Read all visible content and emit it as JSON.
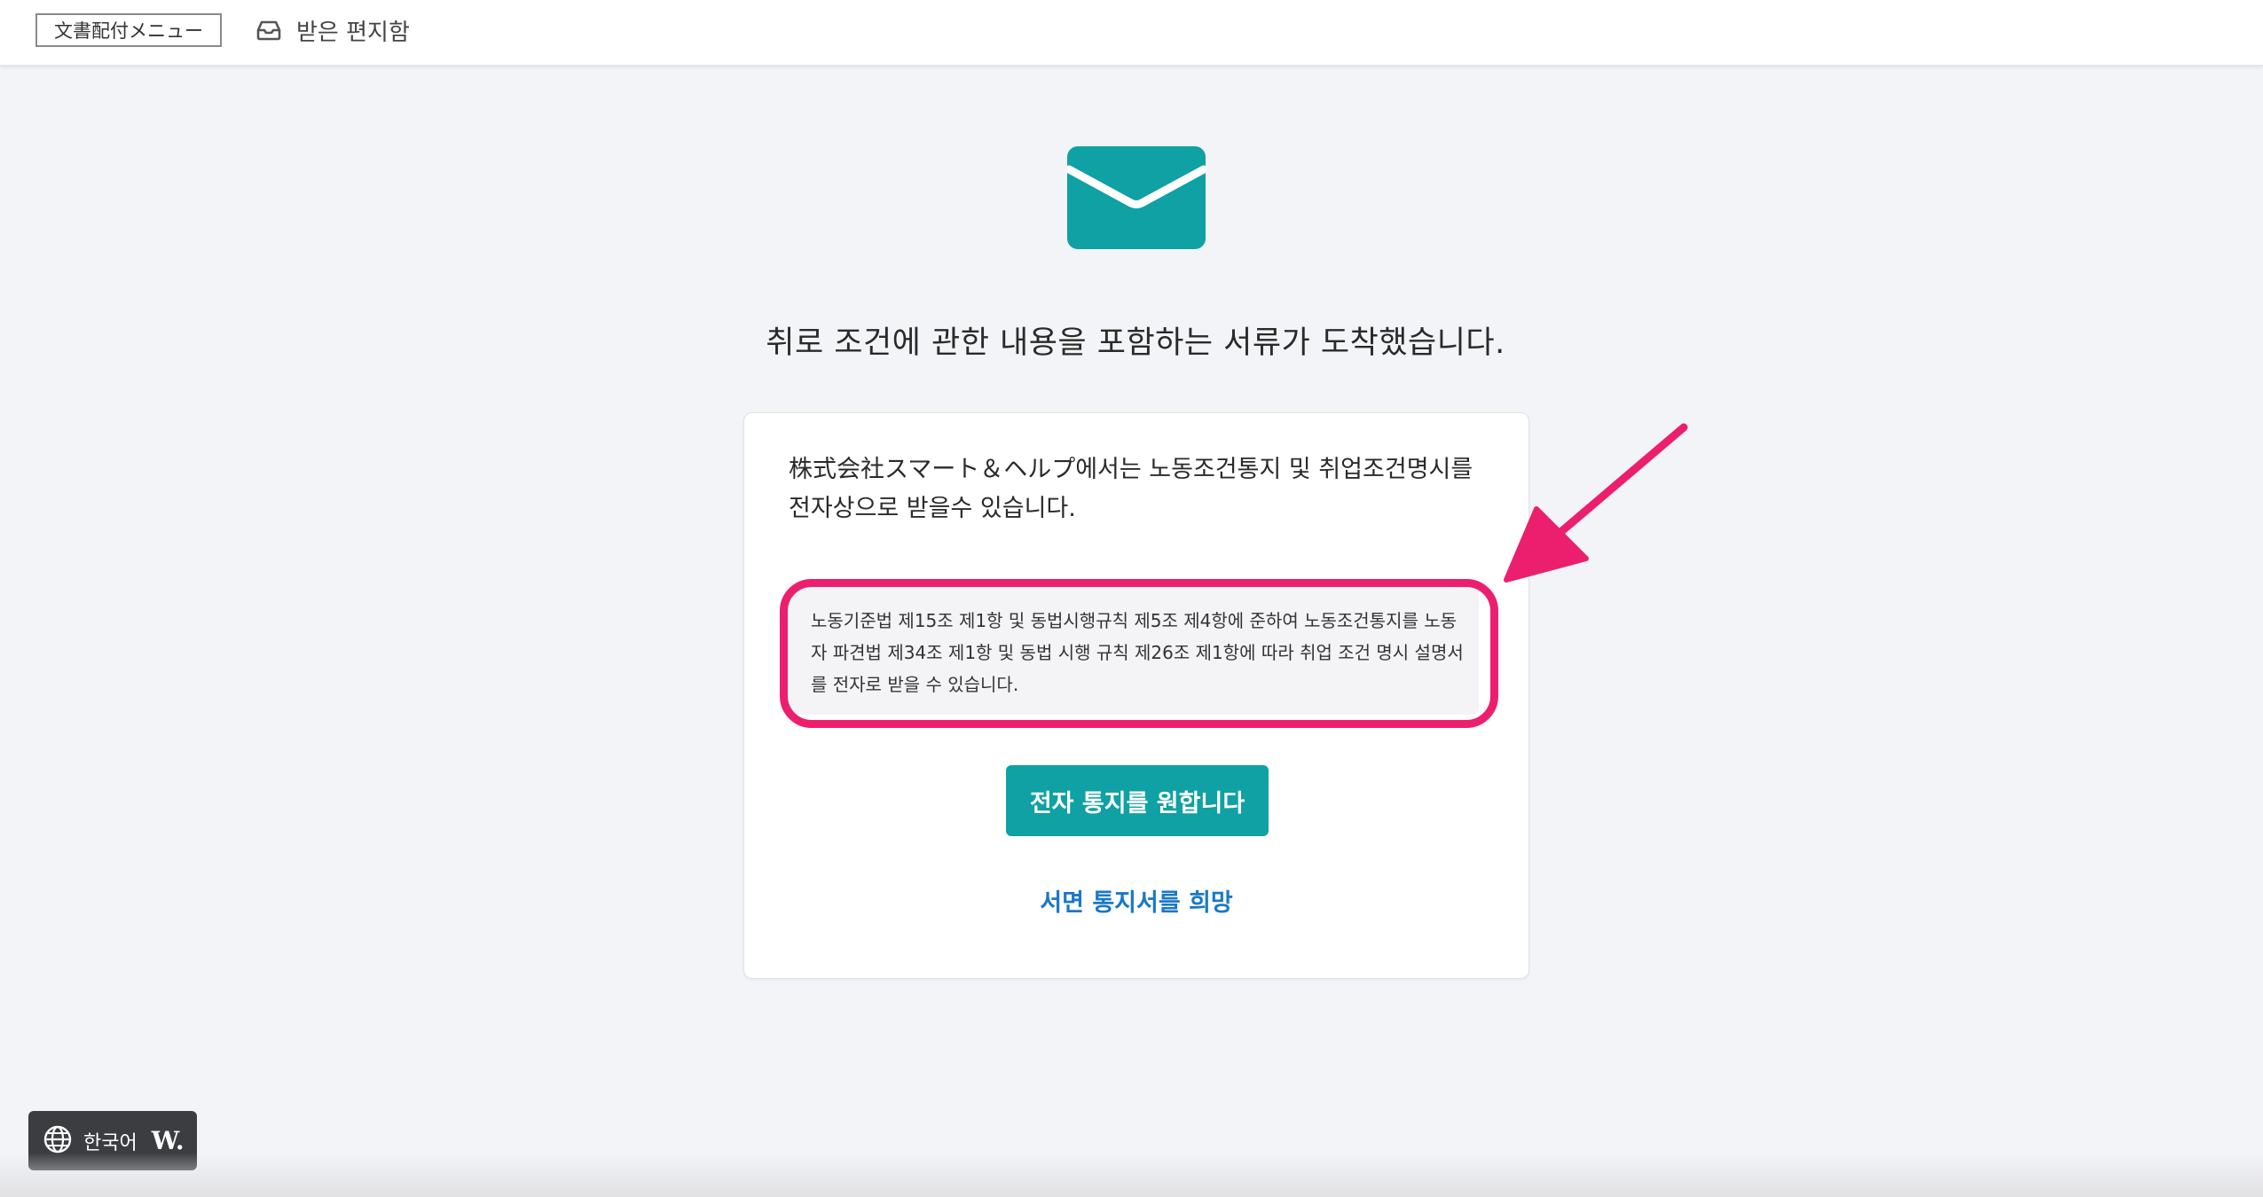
{
  "header": {
    "menu_label": "文書配付メニュー",
    "inbox_icon": "inbox-icon",
    "inbox_label": "받은 편지함"
  },
  "main": {
    "icon": "envelope-icon",
    "headline": "취로 조건에 관한 내용을 포함하는 서류가 도착했습니다."
  },
  "card": {
    "intro": "株式会社スマート＆ヘルプ에서는 노동조건통지 및 취업조건명시를\n전자상으로 받을수 있습니다.",
    "legal_text": "노동기준법 제15조 제1항 및 동법시행규칙 제5조 제4항에 준하여 노동조건통지를 노동자 파견법 제34조 제1항 및 동법 시행 규칙 제26조 제1항에 따라 취업 조건 명시 설명서를 전자로 받을 수 있습니다.",
    "primary_button": "전자 통지를 원합니다",
    "paper_link": "서면 통지서를 희망"
  },
  "language_widget": {
    "globe_icon": "globe-icon",
    "label": "한국어",
    "logo": "W."
  },
  "colors": {
    "accent": "#0fa1a3",
    "link": "#1b78c4",
    "highlight": "#ec1f6e",
    "background": "#f3f4f7"
  }
}
